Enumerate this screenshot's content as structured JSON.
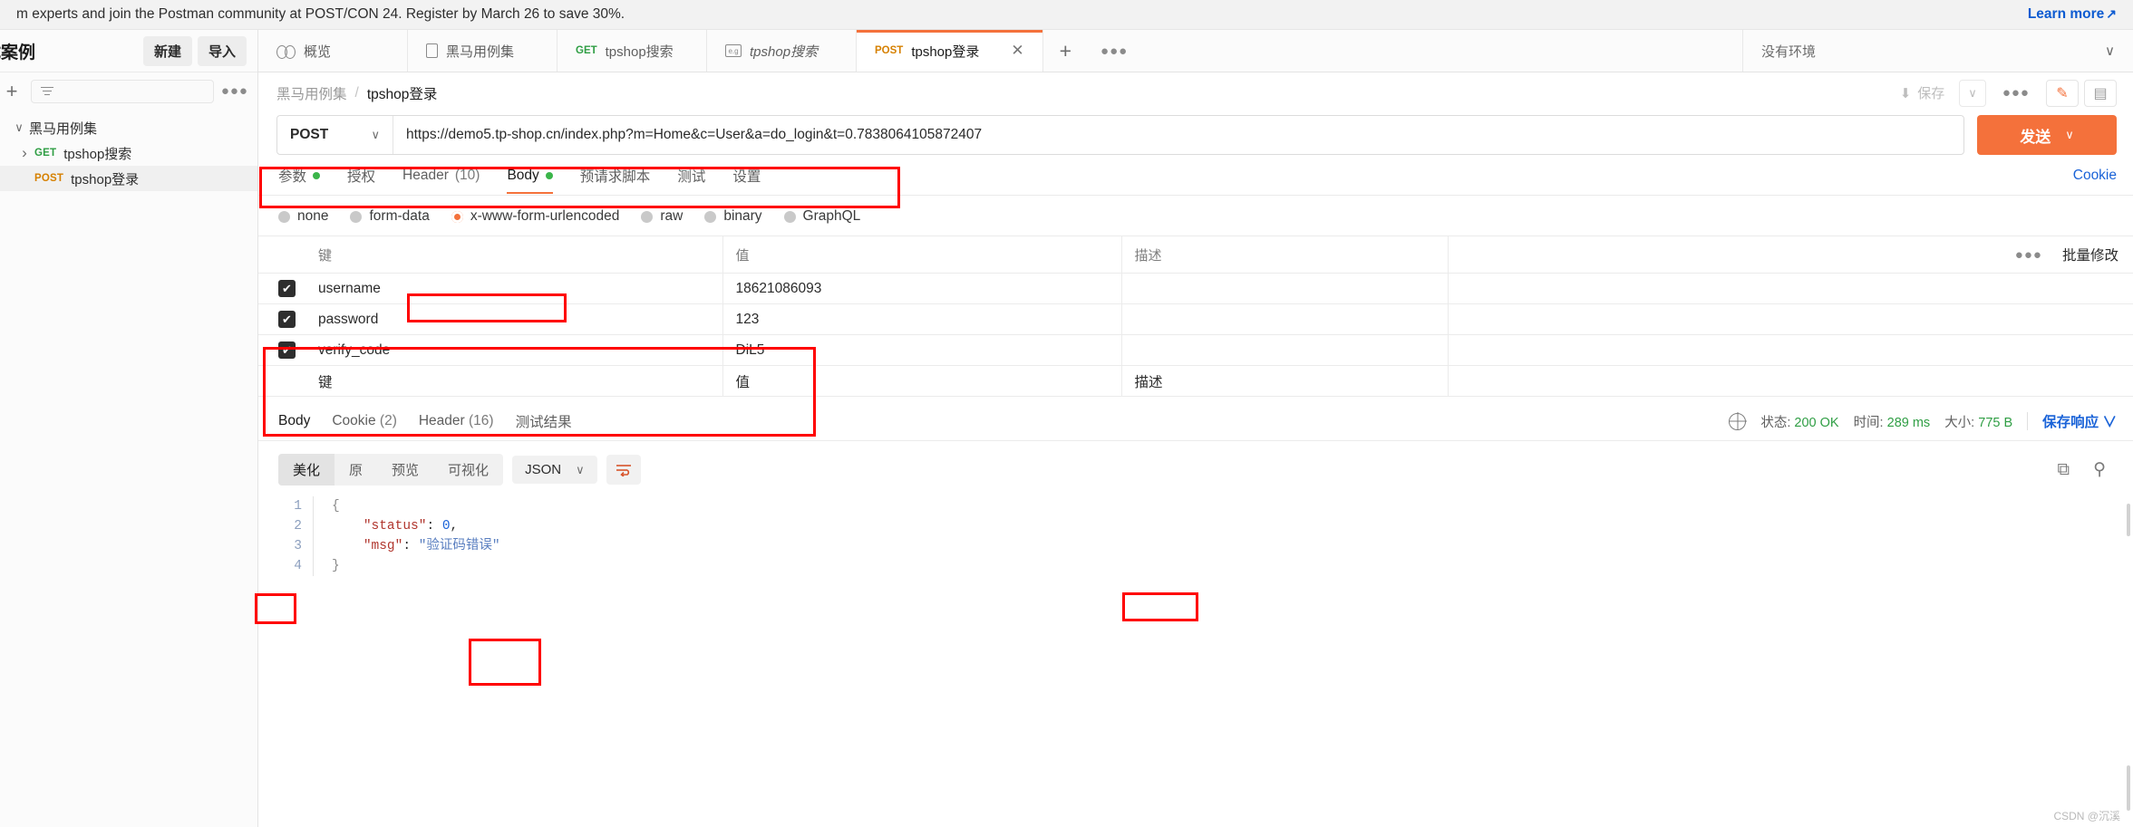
{
  "promo": {
    "text": "m experts and join the Postman community at POST/CON 24. Register by March 26 to save 30%.",
    "link": "Learn more",
    "link_arrow": "↗"
  },
  "sidebar": {
    "title": "试案例",
    "new_button": "新建",
    "import_button": "导入",
    "add_icon": "+",
    "filter_placeholder": "",
    "more_icon": "●●●",
    "tree": [
      {
        "label": "黑马用例集",
        "caret": "down",
        "method": "",
        "selected": false
      },
      {
        "label": "tpshop搜索",
        "caret": "right",
        "method": "GET",
        "selected": false
      },
      {
        "label": "tpshop登录",
        "caret": "",
        "method": "POST",
        "selected": true
      }
    ]
  },
  "tabstrip": {
    "tabs": [
      {
        "label": "概览",
        "icon": "overview-eye-icon",
        "method": "",
        "active": false,
        "italic": false,
        "closable": false
      },
      {
        "label": "黑马用例集",
        "icon": "collection-doc-icon",
        "method": "",
        "active": false,
        "italic": false,
        "closable": false
      },
      {
        "label": "tpshop搜索",
        "icon": "",
        "method": "GET",
        "active": false,
        "italic": false,
        "closable": false
      },
      {
        "label": "tpshop搜索",
        "icon": "example-icon",
        "method": "",
        "active": false,
        "italic": true,
        "closable": false
      },
      {
        "label": "tpshop登录",
        "icon": "",
        "method": "POST",
        "active": true,
        "italic": false,
        "closable": true
      }
    ],
    "close_icon": "✕",
    "plus_icon": "+",
    "dots_icon": "●●●",
    "environment": "没有环境",
    "environment_caret": "∨"
  },
  "breadcrumb": {
    "parent": "黑马用例集",
    "separator": "/",
    "current": "tpshop登录",
    "save_label": "保存",
    "save_icon": "⬇",
    "save_caret": "∨",
    "more_icon": "●●●",
    "edit_icon": "✎",
    "comment_icon": "▤"
  },
  "request": {
    "method": "POST",
    "method_caret": "∨",
    "url": "https://demo5.tp-shop.cn/index.php?m=Home&c=User&a=do_login&t=0.7838064105872407",
    "send_label": "发送",
    "send_caret": "∨"
  },
  "request_tabs": {
    "items": [
      {
        "label": "参数",
        "dot": true,
        "count": "",
        "active": false
      },
      {
        "label": "授权",
        "dot": false,
        "count": "",
        "active": false
      },
      {
        "label": "Header",
        "dot": false,
        "count": "(10)",
        "active": false
      },
      {
        "label": "Body",
        "dot": true,
        "count": "",
        "active": true
      },
      {
        "label": "预请求脚本",
        "dot": false,
        "count": "",
        "active": false
      },
      {
        "label": "测试",
        "dot": false,
        "count": "",
        "active": false
      },
      {
        "label": "设置",
        "dot": false,
        "count": "",
        "active": false
      }
    ],
    "cookie_link": "Cookie"
  },
  "body_types": [
    {
      "label": "none",
      "selected": false
    },
    {
      "label": "form-data",
      "selected": false
    },
    {
      "label": "x-www-form-urlencoded",
      "selected": true
    },
    {
      "label": "raw",
      "selected": false
    },
    {
      "label": "binary",
      "selected": false
    },
    {
      "label": "GraphQL",
      "selected": false
    }
  ],
  "params_table": {
    "headers": {
      "key": "键",
      "value": "值",
      "description": "描述"
    },
    "dots_icon": "●●●",
    "bulk_edit": "批量修改",
    "check_glyph": "✔",
    "rows": [
      {
        "checked": true,
        "key": "username",
        "value": "18621086093",
        "description": ""
      },
      {
        "checked": true,
        "key": "password",
        "value": "123",
        "description": ""
      },
      {
        "checked": true,
        "key": "verify_code",
        "value": "DiL5",
        "description": ""
      }
    ],
    "placeholder_row": {
      "key": "键",
      "value": "值",
      "description": "描述"
    }
  },
  "response": {
    "tabs": [
      {
        "label": "Body",
        "count": "",
        "active": true
      },
      {
        "label": "Cookie",
        "count": "(2)",
        "active": false
      },
      {
        "label": "Header",
        "count": "(16)",
        "active": false
      },
      {
        "label": "测试结果",
        "count": "",
        "active": false
      }
    ],
    "status_label": "状态:",
    "status_value": "200 OK",
    "time_label": "时间:",
    "time_value": "289 ms",
    "size_label": "大小:",
    "size_value": "775 B",
    "save_response": "保存响应",
    "save_response_caret": "∨",
    "viewer": {
      "segments": [
        {
          "label": "美化",
          "active": true
        },
        {
          "label": "原",
          "active": false
        },
        {
          "label": "预览",
          "active": false
        },
        {
          "label": "可视化",
          "active": false
        }
      ],
      "format": "JSON",
      "format_caret": "∨",
      "wrap_icon": "↵",
      "copy_icon": "⧉",
      "search_icon": "⚲"
    },
    "code": {
      "lines": [
        "1",
        "2",
        "3",
        "4"
      ],
      "open_brace": "{",
      "entries": [
        {
          "key": "\"status\"",
          "sep": ": ",
          "value": "0",
          "type": "num",
          "comma": ","
        },
        {
          "key": "\"msg\"",
          "sep": ": ",
          "value": "\"验证码错误\"",
          "type": "str",
          "comma": ""
        }
      ],
      "close_brace": "}"
    }
  },
  "watermark": "CSDN @沉溪"
}
